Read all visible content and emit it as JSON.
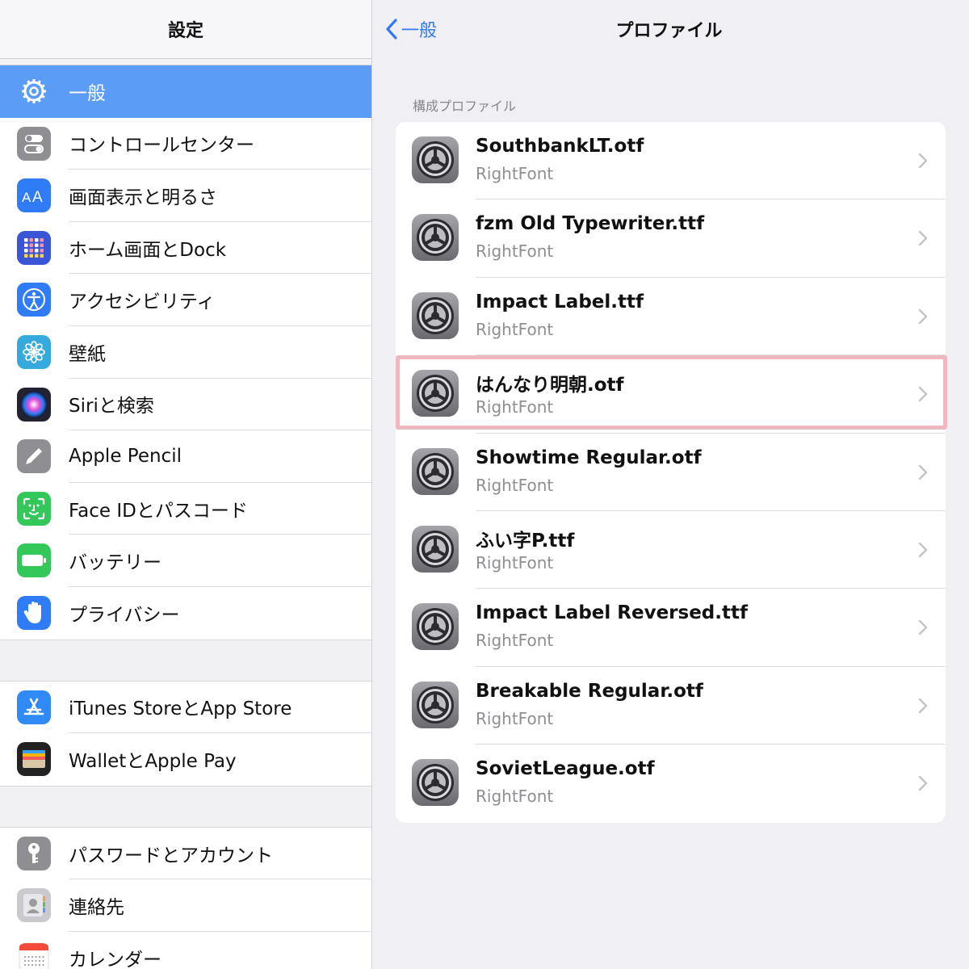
{
  "sidebar": {
    "title": "設定",
    "groups": [
      [
        {
          "label": "一般",
          "icon": "gear-icon",
          "color": "#8e8e93",
          "selected": true
        },
        {
          "label": "コントロールセンター",
          "icon": "toggles-icon",
          "color": "#8e8e93"
        },
        {
          "label": "画面表示と明るさ",
          "icon": "text-size-icon",
          "color": "#2f7cf6"
        },
        {
          "label": "ホーム画面とDock",
          "icon": "home-grid-icon",
          "color": "#3a55d6"
        },
        {
          "label": "アクセシビリティ",
          "icon": "accessibility-icon",
          "color": "#2f7cf6"
        },
        {
          "label": "壁紙",
          "icon": "flower-icon",
          "color": "#36aadc"
        },
        {
          "label": "Siriと検索",
          "icon": "siri-icon",
          "color": "#222233"
        },
        {
          "label": "Apple Pencil",
          "icon": "pencil-icon",
          "color": "#8e8e93"
        },
        {
          "label": "Face IDとパスコード",
          "icon": "face-id-icon",
          "color": "#34c759"
        },
        {
          "label": "バッテリー",
          "icon": "battery-icon",
          "color": "#34c759"
        },
        {
          "label": "プライバシー",
          "icon": "hand-icon",
          "color": "#2f7cf6"
        }
      ],
      [
        {
          "label": "iTunes StoreとApp Store",
          "icon": "app-store-icon",
          "color": "#2f8af6"
        },
        {
          "label": "WalletとApple Pay",
          "icon": "wallet-icon",
          "color": "#222222"
        }
      ],
      [
        {
          "label": "パスワードとアカウント",
          "icon": "key-icon",
          "color": "#8e8e93"
        },
        {
          "label": "連絡先",
          "icon": "contacts-icon",
          "color": "#c9c9ce"
        },
        {
          "label": "カレンダー",
          "icon": "calendar-icon",
          "color": "#ffffff"
        }
      ]
    ]
  },
  "nav": {
    "back_label": "一般",
    "title": "プロファイル"
  },
  "section_label": "構成プロファイル",
  "profiles": [
    {
      "name": "SouthbankLT.otf",
      "sub": "RightFont"
    },
    {
      "name": "fzm Old Typewriter.ttf",
      "sub": "RightFont"
    },
    {
      "name": "Impact Label.ttf",
      "sub": "RightFont"
    },
    {
      "name": "はんなり明朝.otf",
      "sub": "RightFont",
      "highlighted": true
    },
    {
      "name": "Showtime Regular.otf",
      "sub": "RightFont"
    },
    {
      "name": "ふい字P.ttf",
      "sub": "RightFont"
    },
    {
      "name": "Impact Label Reversed.ttf",
      "sub": "RightFont"
    },
    {
      "name": "Breakable  Regular.otf",
      "sub": "RightFont"
    },
    {
      "name": "SovietLeague.otf",
      "sub": "RightFont"
    }
  ],
  "colors": {
    "accent": "#3478f6",
    "selected_row": "#5b9cf7",
    "highlight_border": "#efb8c0"
  }
}
